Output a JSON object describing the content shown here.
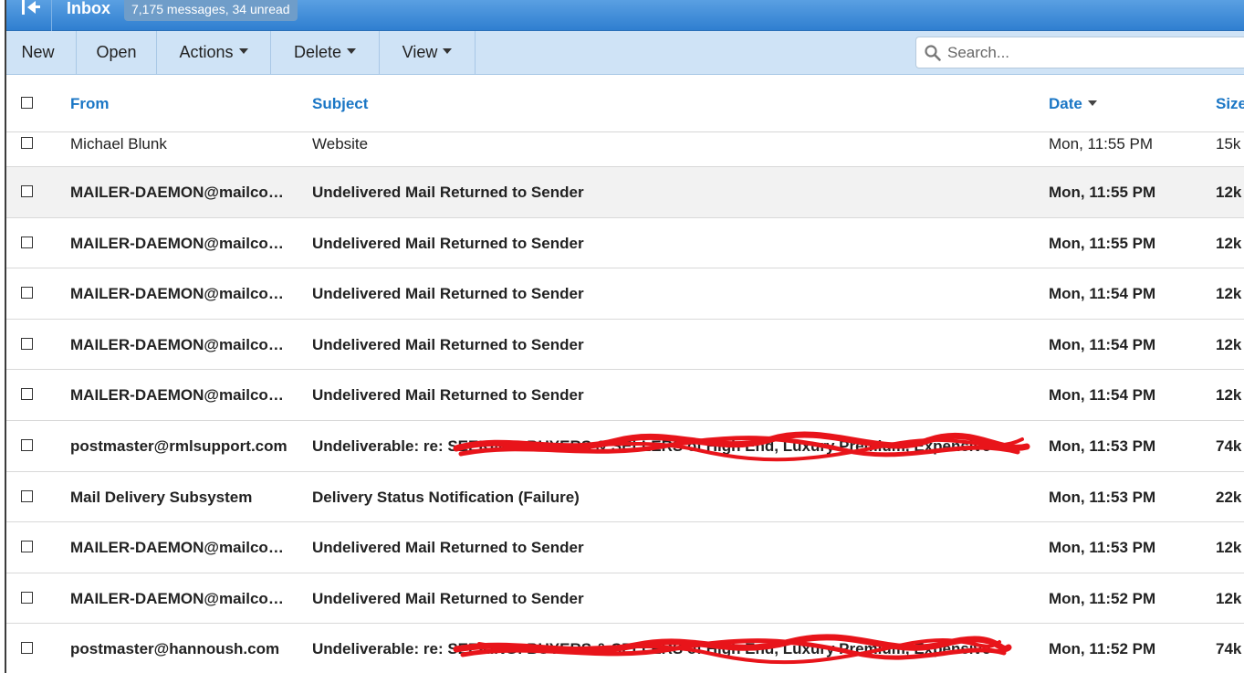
{
  "titlebar": {
    "title": "Inbox",
    "count_badge": "7,175 messages, 34 unread"
  },
  "toolbar": {
    "new_label": "New",
    "open_label": "Open",
    "actions_label": "Actions",
    "delete_label": "Delete",
    "view_label": "View",
    "search_placeholder": "Search..."
  },
  "columns": {
    "from": "From",
    "subject": "Subject",
    "date": "Date",
    "size": "Size"
  },
  "messages": [
    {
      "from": "Michael Blunk",
      "subject": "Website",
      "date": "Mon, 11:55 PM",
      "size": "15k",
      "unread": false
    },
    {
      "from": "MAILER-DAEMON@mailcow.cab.tmgcrowdmail.com",
      "subject": "Undelivered Mail Returned to Sender",
      "date": "Mon, 11:55 PM",
      "size": "12k",
      "unread": true
    },
    {
      "from": "MAILER-DAEMON@mailcow.cab.tmgcrowdmail.com",
      "subject": "Undelivered Mail Returned to Sender",
      "date": "Mon, 11:55 PM",
      "size": "12k",
      "unread": true
    },
    {
      "from": "MAILER-DAEMON@mailcow.cab.tmgcrowdmail.com",
      "subject": "Undelivered Mail Returned to Sender",
      "date": "Mon, 11:54 PM",
      "size": "12k",
      "unread": true
    },
    {
      "from": "MAILER-DAEMON@mailcow.cab.tmgcrowdmail.com",
      "subject": "Undelivered Mail Returned to Sender",
      "date": "Mon, 11:54 PM",
      "size": "12k",
      "unread": true
    },
    {
      "from": "MAILER-DAEMON@mailcow.cab.tmgcrowdmail.com",
      "subject": "Undelivered Mail Returned to Sender",
      "date": "Mon, 11:54 PM",
      "size": "12k",
      "unread": true
    },
    {
      "from": "postmaster@rmlsupport.com",
      "subject": "Undeliverable: re: SEEKING: BUYERS & SELLERS of High End, Luxury Premium, Expensive",
      "date": "Mon, 11:53 PM",
      "size": "74k",
      "unread": true,
      "redacted": true
    },
    {
      "from": "Mail Delivery Subsystem",
      "subject": "Delivery Status Notification (Failure)",
      "date": "Mon, 11:53 PM",
      "size": "22k",
      "unread": true
    },
    {
      "from": "MAILER-DAEMON@mailcow.cab.tmgcrowdmail.com",
      "subject": "Undelivered Mail Returned to Sender",
      "date": "Mon, 11:53 PM",
      "size": "12k",
      "unread": true
    },
    {
      "from": "MAILER-DAEMON@mailcow.cab.tmgcrowdmail.com",
      "subject": "Undelivered Mail Returned to Sender",
      "date": "Mon, 11:52 PM",
      "size": "12k",
      "unread": true
    },
    {
      "from": "postmaster@hannoush.com",
      "subject": "Undeliverable: re: SEEKING: BUYERS & SELLERS of High End, Luxury Premium, Expensive",
      "date": "Mon, 11:52 PM",
      "size": "74k",
      "unread": true,
      "redacted": true
    }
  ],
  "colors": {
    "titlebar": "#3f8ad6",
    "toolbar": "#cfe3f6",
    "header_link": "#1a76c5",
    "redaction": "#e8141a"
  }
}
